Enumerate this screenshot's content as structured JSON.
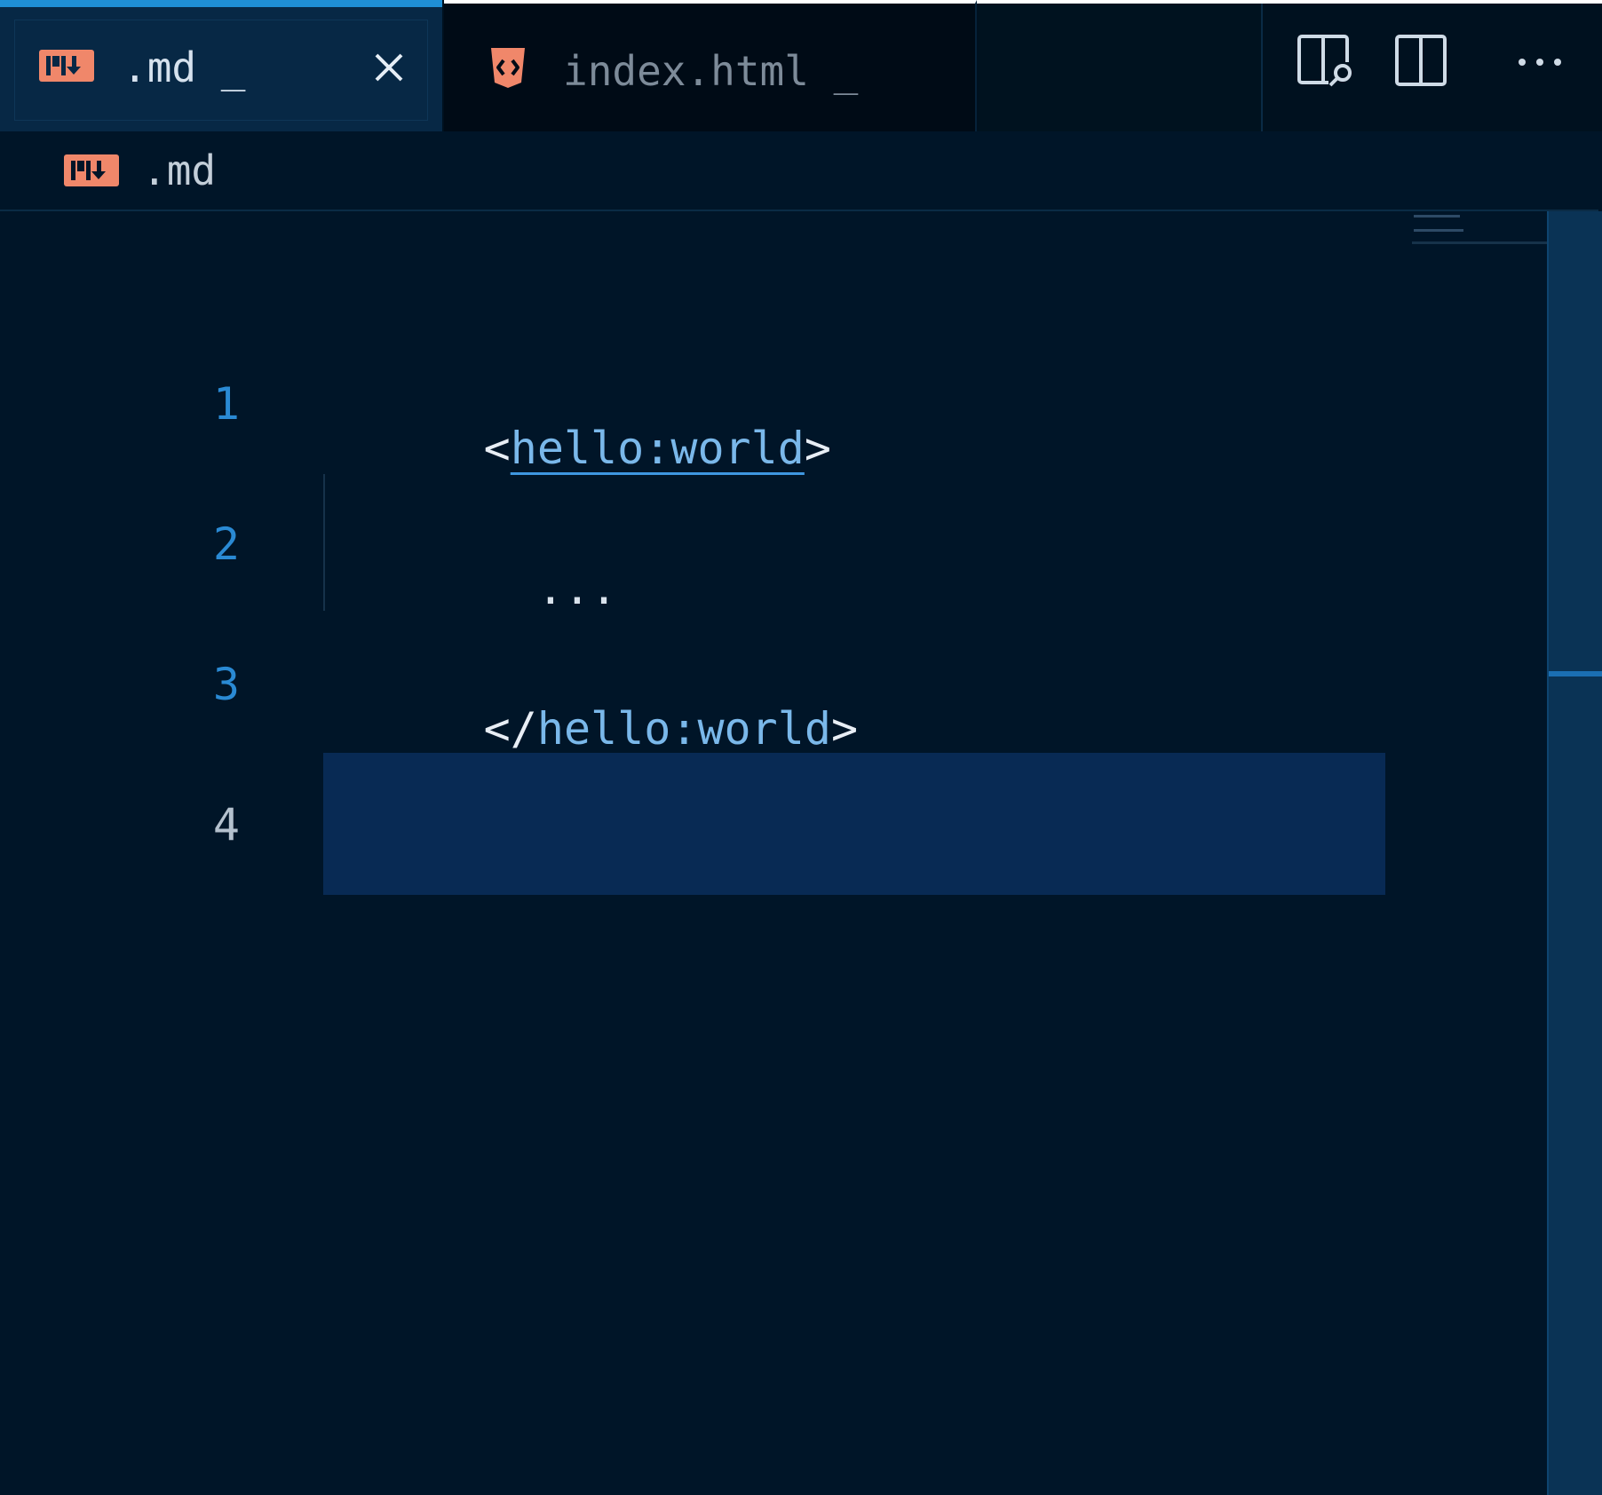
{
  "tabs": [
    {
      "label": ".md _",
      "icon": "markdown-icon",
      "active": true,
      "closable": true
    },
    {
      "label": "index.html _",
      "icon": "html-shield-icon",
      "active": false
    }
  ],
  "toolbar": {
    "open_preview_icon": "open-preview-icon",
    "split_editor_icon": "split-editor-icon",
    "more_actions_label": "···"
  },
  "breadcrumb": {
    "label": ".md",
    "icon": "markdown-icon"
  },
  "editor": {
    "lines": [
      {
        "number": "1",
        "open_bracket": "<",
        "tag": "hello:world",
        "close_bracket": ">"
      },
      {
        "number": "2",
        "text": "  ..."
      },
      {
        "number": "3",
        "open_bracket": "</",
        "tag": "hello:world",
        "close_bracket": ">"
      },
      {
        "number": "4",
        "text": ""
      }
    ],
    "current_line": "4"
  },
  "colors": {
    "background": "#001528",
    "tab_active_accent": "#1f8fd6",
    "markdown_icon": "#f0876a",
    "html_icon": "#f0876a",
    "tag_color": "#7ab8ea",
    "line_number_color": "#2a8ad4",
    "current_line_highlight": "#082a54"
  }
}
